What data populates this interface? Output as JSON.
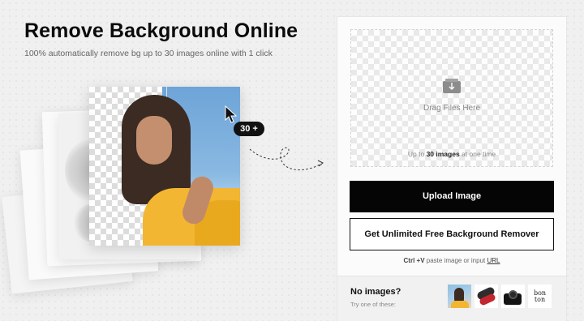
{
  "hero": {
    "title": "Remove Background Online",
    "subtitle": "100% automatically remove bg up to 30 images online with 1 click"
  },
  "illustration": {
    "badge": "30 +"
  },
  "upload": {
    "drag_label": "Drag Files Here",
    "limit_prefix": "Up to ",
    "limit_bold": "30 images",
    "limit_suffix": " at one time",
    "upload_button": "Upload Image",
    "unlimited_button": "Get Unlimited Free Background Remover",
    "paste_kbd": "Ctrl +V",
    "paste_text": " paste image or input ",
    "paste_url": "URL"
  },
  "samples": {
    "heading": "No images?",
    "hint": "Try one of these:",
    "logo_line1": "bon",
    "logo_line2": "ton",
    "items": [
      "woman-beach",
      "sneakers",
      "camera",
      "bonton-logo"
    ]
  },
  "colors": {
    "primary_button": "#050505",
    "accent_yellow": "#f2b632",
    "sky_blue": "#8ab9e2"
  }
}
